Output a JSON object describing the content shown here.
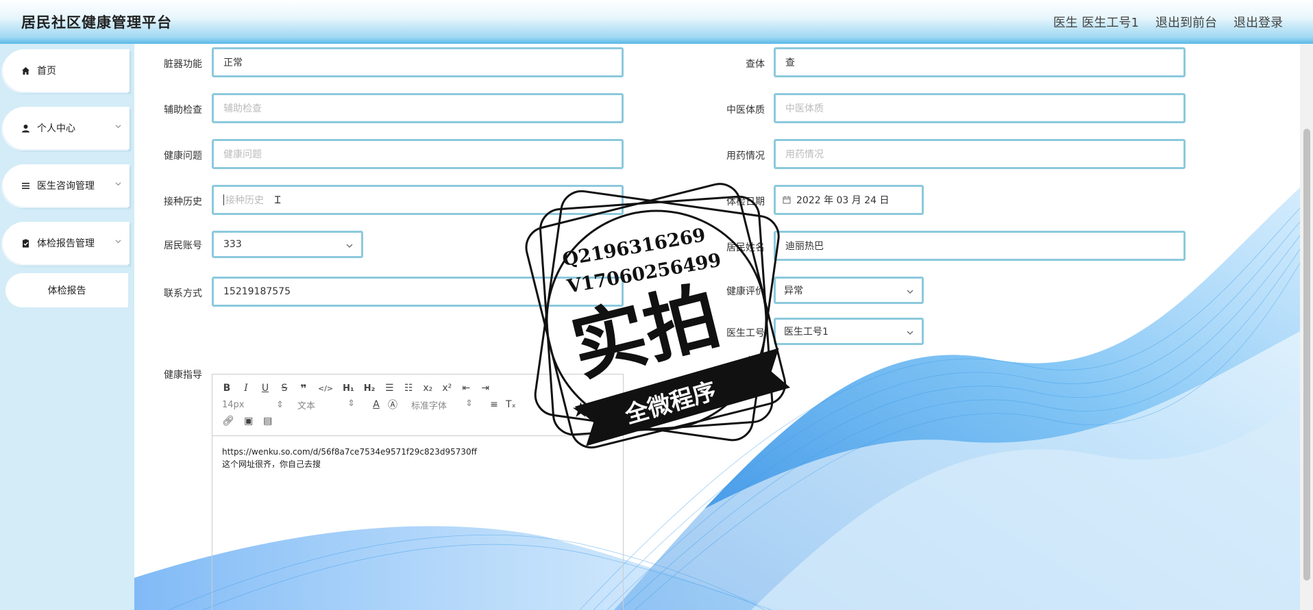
{
  "header": {
    "title": "居民社区健康管理平台",
    "user_label": "医生 医生工号1",
    "front_label": "退出到前台",
    "logout_label": "退出登录"
  },
  "sidebar": {
    "items": [
      {
        "label": "首页",
        "icon": "home-icon"
      },
      {
        "label": "个人中心",
        "icon": "user-icon"
      },
      {
        "label": "医生咨询管理",
        "icon": "list-icon"
      },
      {
        "label": "体检报告管理",
        "icon": "clipboard-icon"
      }
    ],
    "sub_item": "体检报告"
  },
  "form": {
    "organ_label": "脏器功能",
    "organ_value": "正常",
    "exam_label": "查体",
    "exam_value": "查",
    "aux_label": "辅助检查",
    "aux_placeholder": "辅助检查",
    "tcm_label": "中医体质",
    "tcm_placeholder": "中医体质",
    "health_issue_label": "健康问题",
    "health_issue_placeholder": "健康问题",
    "medication_label": "用药情况",
    "medication_placeholder": "用药情况",
    "vaccine_label": "接种历史",
    "vaccine_placeholder": "接种历史",
    "exam_date_label": "体检日期",
    "exam_date_value": "2022 年 03 月 24 日",
    "resident_account_label": "居民账号",
    "resident_account_value": "333",
    "resident_name_label": "居民姓名",
    "resident_name_value": "迪丽热巴",
    "contact_label": "联系方式",
    "contact_value": "15219187575",
    "evaluation_label": "健康评价",
    "evaluation_value": "异常",
    "doctor_id_label": "医生工号",
    "doctor_id_value": "医生工号1",
    "guidance_label": "健康指导"
  },
  "editor": {
    "font_size": "14px",
    "text_type": "文本",
    "font_family": "标准字体",
    "content_line1": "https://wenku.so.com/d/56f8a7ce7534e9571f29c823d95730ff",
    "content_line2": "这个网址很齐，你自己去搜"
  },
  "stamp": {
    "line1": "Q2196316269",
    "line2": "V17060256499",
    "big": "实拍",
    "banner": "全微程序"
  },
  "colors": {
    "accent_border": "#8cc9dc",
    "sidebar_bg": "#d3ecf7",
    "wave": "#3aa0ef"
  }
}
